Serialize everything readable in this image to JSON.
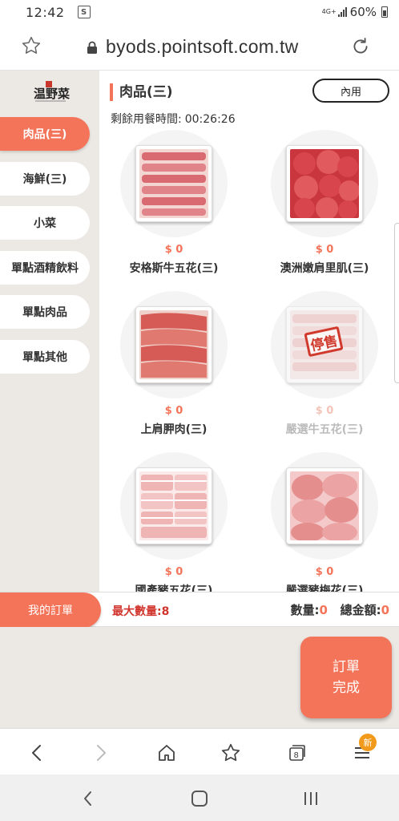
{
  "status_bar": {
    "time": "12:42",
    "network": "4G+",
    "battery": "60%"
  },
  "browser": {
    "url": "byods.pointsoft.com.tw"
  },
  "sidebar": {
    "categories": [
      {
        "label": "肉品(三)",
        "active": true
      },
      {
        "label": "海鮮(三)",
        "active": false
      },
      {
        "label": "小菜",
        "active": false
      },
      {
        "label": "單點酒精飲料",
        "active": false
      },
      {
        "label": "單點肉品",
        "active": false
      },
      {
        "label": "單點其他",
        "active": false
      }
    ]
  },
  "header": {
    "section_title": "肉品(三)",
    "dine_mode": "內用",
    "timer_label": "剩餘用餐時間:",
    "timer_value": "00:26:26"
  },
  "items": [
    {
      "name": "安格斯牛五花(三)",
      "price": "$ 0",
      "available": true,
      "meat_color": "#e0848a"
    },
    {
      "name": "澳洲嫩肩里肌(三)",
      "price": "$ 0",
      "available": true,
      "meat_color": "#d8454c"
    },
    {
      "name": "上肩胛肉(三)",
      "price": "$ 0",
      "available": true,
      "meat_color": "#d65a55"
    },
    {
      "name": "嚴選牛五花(三)",
      "price": "$ 0",
      "available": false,
      "stamp": "停售",
      "meat_color": "#e8a8a8"
    },
    {
      "name": "國產豬五花(三)",
      "price": "$ 0",
      "available": true,
      "meat_color": "#efb5b5"
    },
    {
      "name": "嚴選豬梅花(三)",
      "price": "$ 0",
      "available": true,
      "meat_color": "#e58e8e"
    }
  ],
  "order_bar": {
    "my_order": "我的訂單",
    "max_qty_label": "最大數量:",
    "max_qty_value": "8",
    "qty_label": "數量:",
    "qty_value": "0",
    "total_label": "總金額:",
    "total_value": "0"
  },
  "submit": {
    "line1": "訂單",
    "line2": "完成"
  },
  "browser_nav": {
    "tabs_count": "8",
    "new_badge": "新"
  },
  "colors": {
    "accent": "#f4745a",
    "sidebar_bg": "#ece8e4",
    "warning": "#d0342c"
  }
}
